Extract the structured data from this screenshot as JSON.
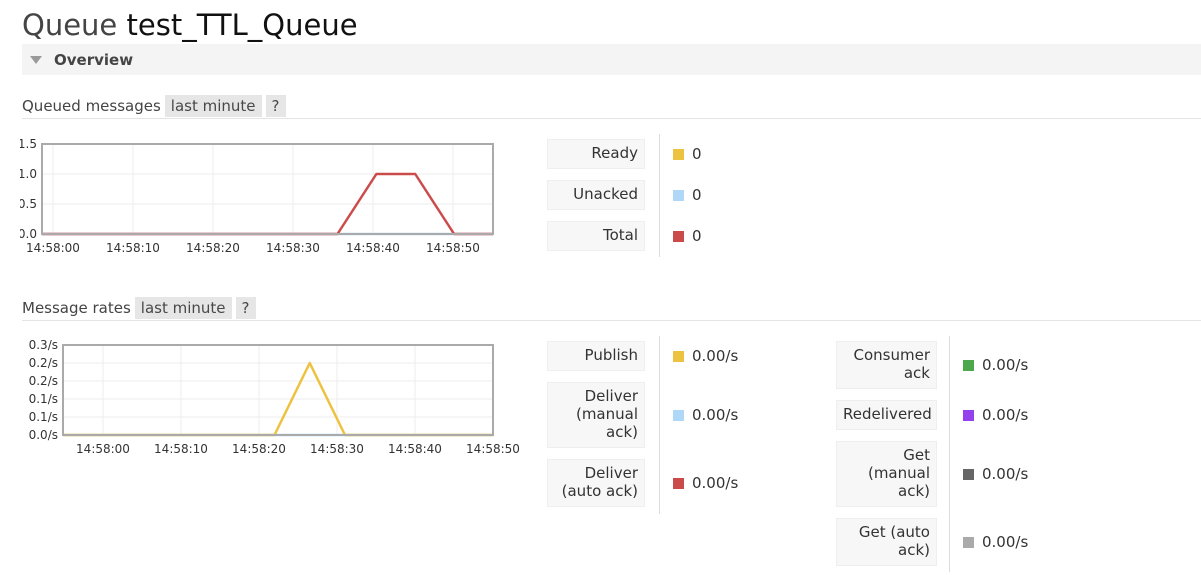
{
  "page": {
    "title_prefix": "Queue",
    "queue_name": "test_TTL_Queue",
    "overview_label": "Overview"
  },
  "queued_messages": {
    "label": "Queued messages",
    "range": "last minute",
    "help": "?",
    "legend": [
      {
        "label": "Ready",
        "value": "0",
        "color": "#edc240"
      },
      {
        "label": "Unacked",
        "value": "0",
        "color": "#afd8f8"
      },
      {
        "label": "Total",
        "value": "0",
        "color": "#cb4b4b"
      }
    ]
  },
  "message_rates": {
    "label": "Message rates",
    "range": "last minute",
    "help": "?",
    "legend_left": [
      {
        "label": "Publish",
        "value": "0.00/s",
        "color": "#edc240"
      },
      {
        "label": "Deliver (manual ack)",
        "value": "0.00/s",
        "color": "#afd8f8"
      },
      {
        "label": "Deliver (auto ack)",
        "value": "0.00/s",
        "color": "#cb4b4b"
      }
    ],
    "legend_right": [
      {
        "label": "Consumer ack",
        "value": "0.00/s",
        "color": "#4da74d"
      },
      {
        "label": "Redelivered",
        "value": "0.00/s",
        "color": "#9440ed"
      },
      {
        "label": "Get (manual ack)",
        "value": "0.00/s",
        "color": "#666666"
      },
      {
        "label": "Get (auto ack)",
        "value": "0.00/s",
        "color": "#aaaaaa"
      }
    ]
  },
  "chart_data": [
    {
      "type": "line",
      "x_tick_labels": [
        "14:58:00",
        "14:58:10",
        "14:58:20",
        "14:58:30",
        "14:58:40",
        "14:58:50"
      ],
      "y_tick_labels": [
        "1.5",
        "1.0",
        "0.5",
        "0.0"
      ],
      "ylim": [
        0,
        1.5
      ],
      "xlim": [
        0,
        58
      ],
      "grid": true,
      "series": [
        {
          "name": "Unacked",
          "color": "#afd8f8",
          "x": [
            0,
            58
          ],
          "y": [
            0,
            0
          ]
        },
        {
          "name": "Total",
          "color": "#cb4b4b",
          "x": [
            0,
            38,
            43,
            48,
            53,
            58
          ],
          "y": [
            0,
            0,
            1,
            1,
            0,
            0
          ]
        }
      ]
    },
    {
      "type": "line",
      "x_tick_labels": [
        "14:58:00",
        "14:58:10",
        "14:58:20",
        "14:58:30",
        "14:58:40",
        "14:58:50"
      ],
      "y_tick_labels": [
        "0.3/s",
        "0.2/s",
        "0.2/s",
        "0.1/s",
        "0.1/s",
        "0.0/s"
      ],
      "ylim": [
        0,
        0.25
      ],
      "xlim": [
        -3,
        58
      ],
      "grid": true,
      "series": [
        {
          "name": "Deliver (manual ack)",
          "color": "#afd8f8",
          "x": [
            -3,
            58
          ],
          "y": [
            0,
            0
          ]
        },
        {
          "name": "Publish",
          "color": "#edc240",
          "x": [
            -3,
            27,
            32,
            37,
            58
          ],
          "y": [
            0,
            0,
            0.2,
            0,
            0
          ]
        }
      ]
    }
  ]
}
